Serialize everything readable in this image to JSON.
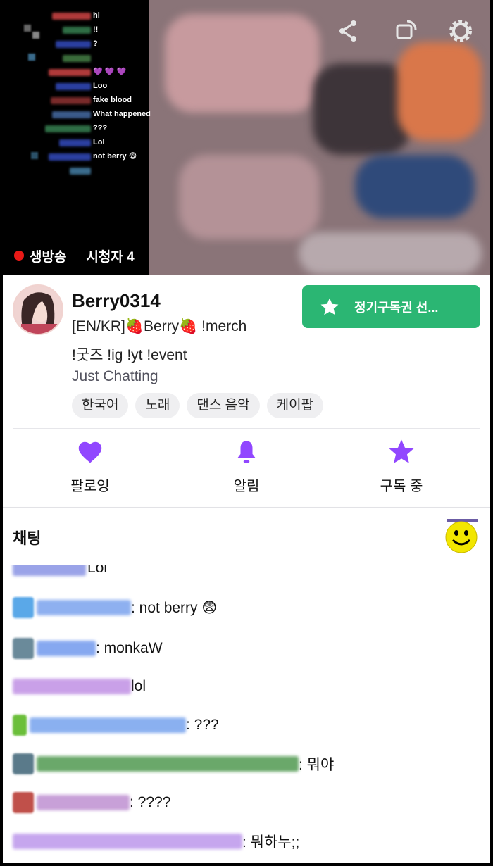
{
  "overlay_chat": {
    "messages": [
      "hi",
      "!!",
      "?",
      "",
      "💜 💜 💜",
      "Loo",
      "fake blood",
      "What happened",
      "???",
      "Lol",
      "not berry 😨",
      ""
    ]
  },
  "stream": {
    "live_label": "생방송",
    "viewers_label": "시청자 4"
  },
  "channel": {
    "name": "Berry0314",
    "title_line1": "[EN/KR]🍓Berry🍓 !merch",
    "title_line2": "!굿즈 !ig !yt !event",
    "category": "Just Chatting",
    "tags": [
      "한국어",
      "노래",
      "댄스 음악",
      "케이팝"
    ],
    "subscribe_button": "정기구독권 선..."
  },
  "actions": {
    "follow_label": "팔로잉",
    "notify_label": "알림",
    "subscribed_label": "구독 중"
  },
  "chat": {
    "title": "채팅",
    "messages": [
      {
        "text": "Lol"
      },
      {
        "text": ": not berry 😨"
      },
      {
        "text": ": monkaW"
      },
      {
        "text": " lol"
      },
      {
        "text": ": ???"
      },
      {
        "text": ": 뭐야"
      },
      {
        "text": ": ????"
      },
      {
        "text": ": 뭐하누;;"
      }
    ]
  },
  "colors": {
    "accent_purple": "#9147ff",
    "subscribe_green": "#2bb673",
    "live_red": "#e91916"
  },
  "icons": {
    "share": "share-icon",
    "rotate": "rotate-icon",
    "settings": "gear-icon",
    "subscribe": "star-icon",
    "follow": "heart-icon",
    "notify": "bell-icon",
    "subscribed": "star-icon"
  }
}
